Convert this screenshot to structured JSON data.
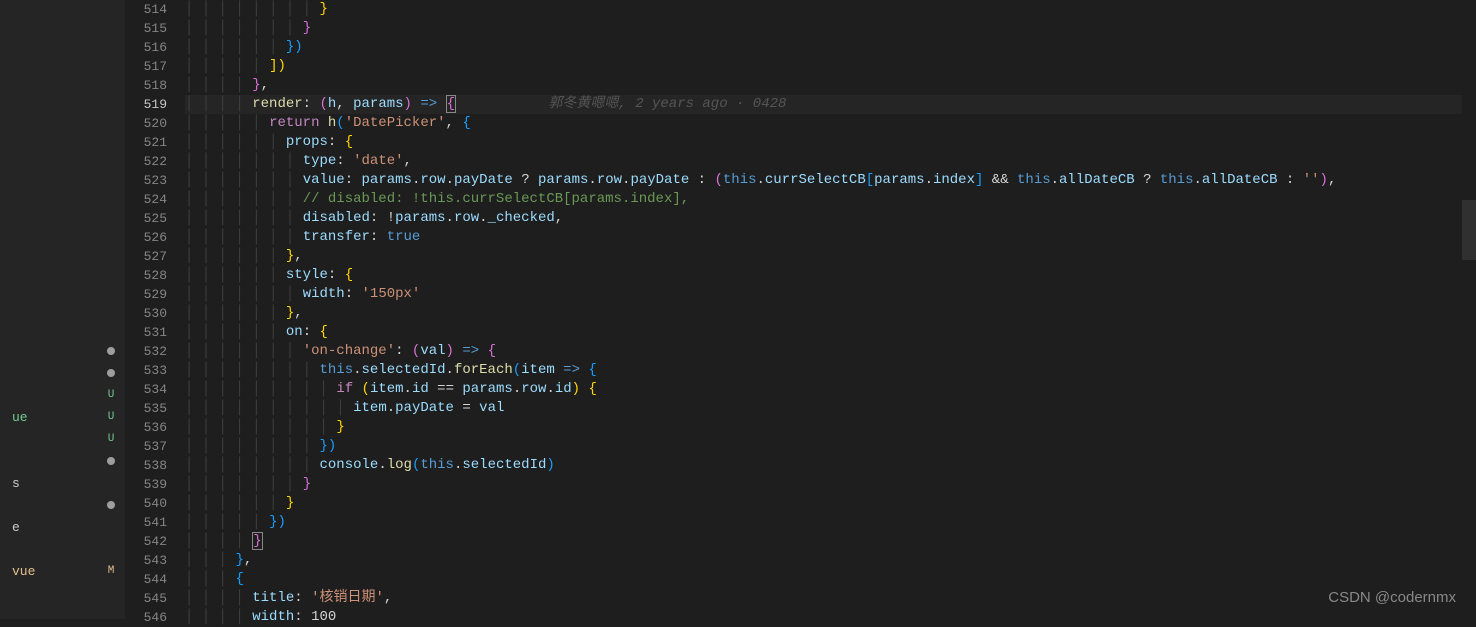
{
  "sidebar": {
    "items": [
      {
        "label": "",
        "marker": "dot"
      },
      {
        "label": "",
        "marker": "dot"
      },
      {
        "label": "",
        "marker": "U",
        "cls": "marker-U"
      },
      {
        "label": "ue",
        "marker": "U",
        "cls": "marker-U file-green"
      },
      {
        "label": "",
        "marker": "U",
        "cls": "marker-U"
      },
      {
        "label": "",
        "marker": "dot"
      },
      {
        "label": "s",
        "marker": ""
      },
      {
        "label": "",
        "marker": "dot"
      },
      {
        "label": "e",
        "marker": ""
      },
      {
        "label": "",
        "marker": ""
      },
      {
        "label": "vue",
        "marker": "M",
        "cls": "marker-M file-orange"
      }
    ]
  },
  "gitlens": "郭冬黄嗯嗯, 2 years ago · 0428",
  "lines": [
    {
      "n": 514,
      "indent": 8,
      "tokens": [
        {
          "t": "}",
          "c": "c-ybracket"
        }
      ]
    },
    {
      "n": 515,
      "indent": 7,
      "tokens": [
        {
          "t": "}",
          "c": "c-pbracket"
        }
      ]
    },
    {
      "n": 516,
      "indent": 6,
      "tokens": [
        {
          "t": "}",
          "c": "c-bbracket"
        },
        {
          "t": ")",
          "c": "c-bbracket"
        }
      ]
    },
    {
      "n": 517,
      "indent": 5,
      "tokens": [
        {
          "t": "]",
          "c": "c-ybracket"
        },
        {
          "t": ")",
          "c": "c-ybracket"
        }
      ]
    },
    {
      "n": 518,
      "indent": 4,
      "tokens": [
        {
          "t": "}",
          "c": "c-pbracket"
        },
        {
          "t": ",",
          "c": "c-white"
        }
      ]
    },
    {
      "n": 519,
      "indent": 4,
      "active": true,
      "tokens": [
        {
          "t": "render",
          "c": "c-yellow"
        },
        {
          "t": ":",
          "c": "c-white"
        },
        {
          "t": " ",
          "c": ""
        },
        {
          "t": "(",
          "c": "c-pbracket"
        },
        {
          "t": "h",
          "c": "c-lightblue"
        },
        {
          "t": ",",
          "c": "c-white"
        },
        {
          "t": " ",
          "c": ""
        },
        {
          "t": "params",
          "c": "c-lightblue"
        },
        {
          "t": ")",
          "c": "c-pbracket"
        },
        {
          "t": " ",
          "c": ""
        },
        {
          "t": "=>",
          "c": "c-blue"
        },
        {
          "t": " ",
          "c": ""
        },
        {
          "t": "{",
          "c": "c-pbracket cursor-brace"
        }
      ],
      "gitlens": true
    },
    {
      "n": 520,
      "indent": 5,
      "tokens": [
        {
          "t": "return",
          "c": "c-purple"
        },
        {
          "t": " ",
          "c": ""
        },
        {
          "t": "h",
          "c": "c-yellow"
        },
        {
          "t": "(",
          "c": "c-bbracket"
        },
        {
          "t": "'DatePicker'",
          "c": "c-orange"
        },
        {
          "t": ",",
          "c": "c-white"
        },
        {
          "t": " ",
          "c": ""
        },
        {
          "t": "{",
          "c": "c-bbracket"
        }
      ]
    },
    {
      "n": 521,
      "indent": 6,
      "tokens": [
        {
          "t": "props",
          "c": "c-lightblue"
        },
        {
          "t": ":",
          "c": "c-white"
        },
        {
          "t": " ",
          "c": ""
        },
        {
          "t": "{",
          "c": "c-ybracket"
        }
      ]
    },
    {
      "n": 522,
      "indent": 7,
      "tokens": [
        {
          "t": "type",
          "c": "c-lightblue"
        },
        {
          "t": ":",
          "c": "c-white"
        },
        {
          "t": " ",
          "c": ""
        },
        {
          "t": "'date'",
          "c": "c-orange"
        },
        {
          "t": ",",
          "c": "c-white"
        }
      ]
    },
    {
      "n": 523,
      "indent": 7,
      "tokens": [
        {
          "t": "value",
          "c": "c-lightblue"
        },
        {
          "t": ":",
          "c": "c-white"
        },
        {
          "t": " ",
          "c": ""
        },
        {
          "t": "params",
          "c": "c-lightblue"
        },
        {
          "t": ".",
          "c": "c-white"
        },
        {
          "t": "row",
          "c": "c-lightblue"
        },
        {
          "t": ".",
          "c": "c-white"
        },
        {
          "t": "payDate",
          "c": "c-lightblue"
        },
        {
          "t": " ",
          "c": ""
        },
        {
          "t": "?",
          "c": "c-white"
        },
        {
          "t": " ",
          "c": ""
        },
        {
          "t": "params",
          "c": "c-lightblue"
        },
        {
          "t": ".",
          "c": "c-white"
        },
        {
          "t": "row",
          "c": "c-lightblue"
        },
        {
          "t": ".",
          "c": "c-white"
        },
        {
          "t": "payDate",
          "c": "c-lightblue"
        },
        {
          "t": " ",
          "c": ""
        },
        {
          "t": ":",
          "c": "c-white"
        },
        {
          "t": " ",
          "c": ""
        },
        {
          "t": "(",
          "c": "c-pbracket"
        },
        {
          "t": "this",
          "c": "c-blue"
        },
        {
          "t": ".",
          "c": "c-white"
        },
        {
          "t": "currSelectCB",
          "c": "c-lightblue"
        },
        {
          "t": "[",
          "c": "c-bbracket"
        },
        {
          "t": "params",
          "c": "c-lightblue"
        },
        {
          "t": ".",
          "c": "c-white"
        },
        {
          "t": "index",
          "c": "c-lightblue"
        },
        {
          "t": "]",
          "c": "c-bbracket"
        },
        {
          "t": " ",
          "c": ""
        },
        {
          "t": "&&",
          "c": "c-white"
        },
        {
          "t": " ",
          "c": ""
        },
        {
          "t": "this",
          "c": "c-blue"
        },
        {
          "t": ".",
          "c": "c-white"
        },
        {
          "t": "allDateCB",
          "c": "c-lightblue"
        },
        {
          "t": " ",
          "c": ""
        },
        {
          "t": "?",
          "c": "c-white"
        },
        {
          "t": " ",
          "c": ""
        },
        {
          "t": "this",
          "c": "c-blue"
        },
        {
          "t": ".",
          "c": "c-white"
        },
        {
          "t": "allDateCB",
          "c": "c-lightblue"
        },
        {
          "t": " ",
          "c": ""
        },
        {
          "t": ":",
          "c": "c-white"
        },
        {
          "t": " ",
          "c": ""
        },
        {
          "t": "''",
          "c": "c-orange"
        },
        {
          "t": ")",
          "c": "c-pbracket"
        },
        {
          "t": ",",
          "c": "c-white"
        }
      ]
    },
    {
      "n": 524,
      "indent": 7,
      "tokens": [
        {
          "t": "// disabled: !this.currSelectCB[params.index],",
          "c": "c-comment"
        }
      ]
    },
    {
      "n": 525,
      "indent": 7,
      "tokens": [
        {
          "t": "disabled",
          "c": "c-lightblue"
        },
        {
          "t": ":",
          "c": "c-white"
        },
        {
          "t": " ",
          "c": ""
        },
        {
          "t": "!",
          "c": "c-white"
        },
        {
          "t": "params",
          "c": "c-lightblue"
        },
        {
          "t": ".",
          "c": "c-white"
        },
        {
          "t": "row",
          "c": "c-lightblue"
        },
        {
          "t": ".",
          "c": "c-white"
        },
        {
          "t": "_checked",
          "c": "c-lightblue"
        },
        {
          "t": ",",
          "c": "c-white"
        }
      ]
    },
    {
      "n": 526,
      "indent": 7,
      "tokens": [
        {
          "t": "transfer",
          "c": "c-lightblue"
        },
        {
          "t": ":",
          "c": "c-white"
        },
        {
          "t": " ",
          "c": ""
        },
        {
          "t": "true",
          "c": "c-blue"
        }
      ]
    },
    {
      "n": 527,
      "indent": 6,
      "tokens": [
        {
          "t": "}",
          "c": "c-ybracket"
        },
        {
          "t": ",",
          "c": "c-white"
        }
      ]
    },
    {
      "n": 528,
      "indent": 6,
      "tokens": [
        {
          "t": "style",
          "c": "c-lightblue"
        },
        {
          "t": ":",
          "c": "c-white"
        },
        {
          "t": " ",
          "c": ""
        },
        {
          "t": "{",
          "c": "c-ybracket"
        }
      ]
    },
    {
      "n": 529,
      "indent": 7,
      "tokens": [
        {
          "t": "width",
          "c": "c-lightblue"
        },
        {
          "t": ":",
          "c": "c-white"
        },
        {
          "t": " ",
          "c": ""
        },
        {
          "t": "'150px'",
          "c": "c-orange"
        }
      ]
    },
    {
      "n": 530,
      "indent": 6,
      "tokens": [
        {
          "t": "}",
          "c": "c-ybracket"
        },
        {
          "t": ",",
          "c": "c-white"
        }
      ]
    },
    {
      "n": 531,
      "indent": 6,
      "tokens": [
        {
          "t": "on",
          "c": "c-lightblue"
        },
        {
          "t": ":",
          "c": "c-white"
        },
        {
          "t": " ",
          "c": ""
        },
        {
          "t": "{",
          "c": "c-ybracket"
        }
      ]
    },
    {
      "n": 532,
      "indent": 7,
      "tokens": [
        {
          "t": "'on-change'",
          "c": "c-orange"
        },
        {
          "t": ":",
          "c": "c-white"
        },
        {
          "t": " ",
          "c": ""
        },
        {
          "t": "(",
          "c": "c-pbracket"
        },
        {
          "t": "val",
          "c": "c-lightblue"
        },
        {
          "t": ")",
          "c": "c-pbracket"
        },
        {
          "t": " ",
          "c": ""
        },
        {
          "t": "=>",
          "c": "c-blue"
        },
        {
          "t": " ",
          "c": ""
        },
        {
          "t": "{",
          "c": "c-pbracket"
        }
      ]
    },
    {
      "n": 533,
      "indent": 8,
      "tokens": [
        {
          "t": "this",
          "c": "c-blue"
        },
        {
          "t": ".",
          "c": "c-white"
        },
        {
          "t": "selectedId",
          "c": "c-lightblue"
        },
        {
          "t": ".",
          "c": "c-white"
        },
        {
          "t": "forEach",
          "c": "c-yellow"
        },
        {
          "t": "(",
          "c": "c-bbracket"
        },
        {
          "t": "item",
          "c": "c-lightblue"
        },
        {
          "t": " ",
          "c": ""
        },
        {
          "t": "=>",
          "c": "c-blue"
        },
        {
          "t": " ",
          "c": ""
        },
        {
          "t": "{",
          "c": "c-bbracket"
        }
      ]
    },
    {
      "n": 534,
      "indent": 9,
      "tokens": [
        {
          "t": "if",
          "c": "c-purple"
        },
        {
          "t": " ",
          "c": ""
        },
        {
          "t": "(",
          "c": "c-ybracket"
        },
        {
          "t": "item",
          "c": "c-lightblue"
        },
        {
          "t": ".",
          "c": "c-white"
        },
        {
          "t": "id",
          "c": "c-lightblue"
        },
        {
          "t": " ",
          "c": ""
        },
        {
          "t": "==",
          "c": "c-white"
        },
        {
          "t": " ",
          "c": ""
        },
        {
          "t": "params",
          "c": "c-lightblue"
        },
        {
          "t": ".",
          "c": "c-white"
        },
        {
          "t": "row",
          "c": "c-lightblue"
        },
        {
          "t": ".",
          "c": "c-white"
        },
        {
          "t": "id",
          "c": "c-lightblue"
        },
        {
          "t": ")",
          "c": "c-ybracket"
        },
        {
          "t": " ",
          "c": ""
        },
        {
          "t": "{",
          "c": "c-ybracket"
        }
      ]
    },
    {
      "n": 535,
      "indent": 10,
      "tokens": [
        {
          "t": "item",
          "c": "c-lightblue"
        },
        {
          "t": ".",
          "c": "c-white"
        },
        {
          "t": "payDate",
          "c": "c-lightblue"
        },
        {
          "t": " ",
          "c": ""
        },
        {
          "t": "=",
          "c": "c-white"
        },
        {
          "t": " ",
          "c": ""
        },
        {
          "t": "val",
          "c": "c-lightblue"
        }
      ]
    },
    {
      "n": 536,
      "indent": 9,
      "tokens": [
        {
          "t": "}",
          "c": "c-ybracket"
        }
      ]
    },
    {
      "n": 537,
      "indent": 8,
      "tokens": [
        {
          "t": "}",
          "c": "c-bbracket"
        },
        {
          "t": ")",
          "c": "c-bbracket"
        }
      ]
    },
    {
      "n": 538,
      "indent": 8,
      "tokens": [
        {
          "t": "console",
          "c": "c-lightblue"
        },
        {
          "t": ".",
          "c": "c-white"
        },
        {
          "t": "log",
          "c": "c-yellow"
        },
        {
          "t": "(",
          "c": "c-bbracket"
        },
        {
          "t": "this",
          "c": "c-blue"
        },
        {
          "t": ".",
          "c": "c-white"
        },
        {
          "t": "selectedId",
          "c": "c-lightblue"
        },
        {
          "t": ")",
          "c": "c-bbracket"
        }
      ]
    },
    {
      "n": 539,
      "indent": 7,
      "tokens": [
        {
          "t": "}",
          "c": "c-pbracket"
        }
      ]
    },
    {
      "n": 540,
      "indent": 6,
      "tokens": [
        {
          "t": "}",
          "c": "c-ybracket"
        }
      ]
    },
    {
      "n": 541,
      "indent": 5,
      "tokens": [
        {
          "t": "}",
          "c": "c-bbracket"
        },
        {
          "t": ")",
          "c": "c-bbracket"
        }
      ]
    },
    {
      "n": 542,
      "indent": 4,
      "tokens": [
        {
          "t": "}",
          "c": "c-pbracket cursor-match"
        }
      ]
    },
    {
      "n": 543,
      "indent": 3,
      "tokens": [
        {
          "t": "}",
          "c": "c-bbracket"
        },
        {
          "t": ",",
          "c": "c-white"
        }
      ]
    },
    {
      "n": 544,
      "indent": 3,
      "tokens": [
        {
          "t": "{",
          "c": "c-bbracket"
        }
      ]
    },
    {
      "n": 545,
      "indent": 4,
      "tokens": [
        {
          "t": "title",
          "c": "c-lightblue"
        },
        {
          "t": ":",
          "c": "c-white"
        },
        {
          "t": " ",
          "c": ""
        },
        {
          "t": "'核销日期'",
          "c": "c-orange"
        },
        {
          "t": ",",
          "c": "c-white"
        }
      ]
    },
    {
      "n": 546,
      "indent": 4,
      "tokens": [
        {
          "t": "width",
          "c": "c-lightblue"
        },
        {
          "t": ":",
          "c": "c-white"
        },
        {
          "t": " ",
          "c": ""
        },
        {
          "t": "100",
          "c": "c-white"
        }
      ]
    }
  ],
  "watermark": "CSDN @codernmx"
}
